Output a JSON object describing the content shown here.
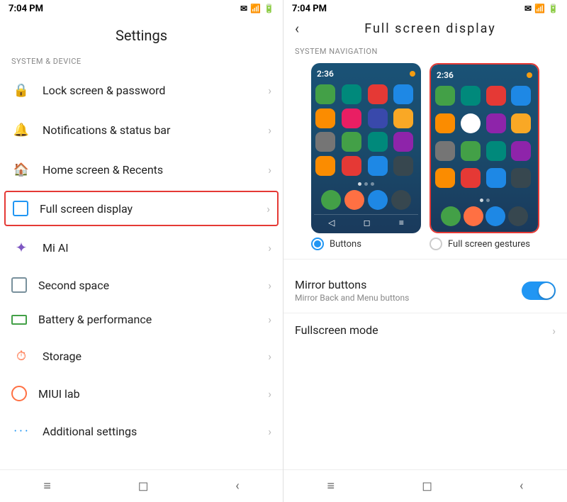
{
  "left": {
    "status_bar": {
      "time": "7:04 PM"
    },
    "title": "Settings",
    "section_label": "SYSTEM & DEVICE",
    "menu_items": [
      {
        "id": "lock-screen",
        "icon": "🔒",
        "icon_color": "#e91e63",
        "label": "Lock screen & password",
        "active": false
      },
      {
        "id": "notifications",
        "icon": "🔔",
        "icon_color": "#2196F3",
        "label": "Notifications & status bar",
        "active": false
      },
      {
        "id": "home-screen",
        "icon": "🏠",
        "icon_color": "#43a047",
        "label": "Home screen & Recents",
        "active": false
      },
      {
        "id": "full-screen",
        "icon": "⬜",
        "icon_color": "#2196F3",
        "label": "Full screen display",
        "active": true
      },
      {
        "id": "mi-ai",
        "icon": "✦",
        "icon_color": "#7e57c2",
        "label": "Mi AI",
        "active": false
      },
      {
        "id": "second-space",
        "icon": "⧉",
        "icon_color": "#78909c",
        "label": "Second space",
        "active": false
      },
      {
        "id": "battery",
        "icon": "⬛",
        "icon_color": "#43a047",
        "label": "Battery & performance",
        "active": false
      },
      {
        "id": "storage",
        "icon": "⏱",
        "icon_color": "#ff7043",
        "label": "Storage",
        "active": false
      },
      {
        "id": "miui-lab",
        "icon": "⚗",
        "icon_color": "#ff7043",
        "label": "MIUI lab",
        "active": false
      },
      {
        "id": "additional",
        "icon": "···",
        "icon_color": "#2196F3",
        "label": "Additional settings",
        "active": false
      }
    ],
    "bottom_nav": {
      "menu": "≡",
      "home": "◻",
      "back": "‹"
    }
  },
  "right": {
    "status_bar": {
      "time": "7:04 PM"
    },
    "back_label": "‹",
    "title": "Full  screen  display",
    "system_nav_label": "SYSTEM NAVIGATION",
    "previews": [
      {
        "id": "buttons",
        "time": "2:36",
        "option_label": "Buttons",
        "selected": true
      },
      {
        "id": "fullscreen",
        "time": "2:36",
        "option_label": "Full screen gestures",
        "selected": false
      }
    ],
    "settings": [
      {
        "id": "mirror-buttons",
        "title": "Mirror buttons",
        "subtitle": "Mirror Back and Menu buttons",
        "control": "toggle",
        "enabled": true
      },
      {
        "id": "fullscreen-mode",
        "title": "Fullscreen mode",
        "subtitle": "",
        "control": "arrow",
        "enabled": false
      }
    ],
    "bottom_nav": {
      "menu": "≡",
      "home": "◻",
      "back": "‹"
    }
  }
}
